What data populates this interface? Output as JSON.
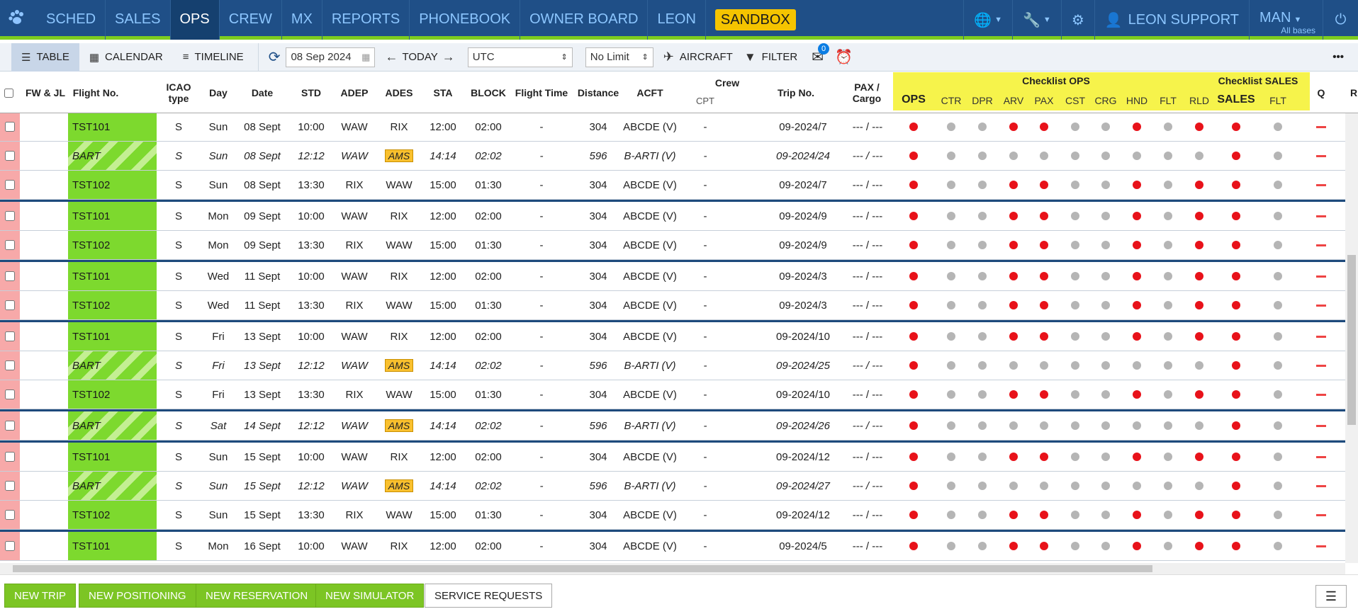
{
  "nav": {
    "items": [
      {
        "label": "SCHED"
      },
      {
        "label": "SALES"
      },
      {
        "label": "OPS"
      },
      {
        "label": "CREW"
      },
      {
        "label": "MX"
      },
      {
        "label": "REPORTS"
      },
      {
        "label": "PHONEBOOK"
      },
      {
        "label": "OWNER BOARD"
      },
      {
        "label": "LEON"
      }
    ],
    "active": "OPS",
    "sandbox": "SANDBOX",
    "user": "LEON SUPPORT",
    "base": "MAN",
    "base_sub": "All bases"
  },
  "toolbar": {
    "table": "TABLE",
    "calendar": "CALENDAR",
    "timeline": "TIMELINE",
    "date": "08 Sep 2024",
    "today": "TODAY",
    "timezone": "UTC",
    "limit": "No Limit",
    "aircraft": "AIRCRAFT",
    "filter": "FILTER",
    "messages_count": "0"
  },
  "columns": {
    "fw_jl": "FW & JL",
    "flight_no": "Flight No.",
    "icao_type": "ICAO type",
    "day": "Day",
    "date": "Date",
    "std": "STD",
    "adep": "ADEP",
    "ades": "ADES",
    "sta": "STA",
    "block": "BLOCK",
    "flight_time": "Flight Time",
    "distance": "Distance",
    "acft": "ACFT",
    "crew": "Crew",
    "cpt": "CPT",
    "trip_no": "Trip No.",
    "pax_cargo": "PAX / Cargo",
    "checklist_ops_title": "Checklist OPS",
    "checklist_sales_title": "Checklist SALES",
    "ops": "OPS",
    "ctr": "CTR",
    "dpr": "DPR",
    "arv": "ARV",
    "pax": "PAX",
    "cst": "CST",
    "crg": "CRG",
    "hnd": "HND",
    "flt": "FLT",
    "rld": "RLD",
    "sales": "SALES",
    "sales_flt": "FLT",
    "q": "Q",
    "r": "R"
  },
  "rows": [
    {
      "flight": "TST101",
      "type": "S",
      "day": "Sun",
      "date": "08 Sept",
      "std": "10:00",
      "adep": "WAW",
      "ades": "RIX",
      "sta": "12:00",
      "block": "02:00",
      "ft": "-",
      "dist": "304",
      "acft": "ABCDE (V)",
      "cpt": "-",
      "trip": "09-2024/7",
      "pax": "--- / ---",
      "bart": false,
      "sep": true,
      "checks": [
        "red",
        "gray",
        "gray",
        "red",
        "red",
        "gray",
        "gray",
        "red",
        "gray",
        "red",
        "red",
        "gray"
      ]
    },
    {
      "flight": "BART",
      "type": "S",
      "day": "Sun",
      "date": "08 Sept",
      "std": "12:12",
      "adep": "WAW",
      "ades": "AMS",
      "sta": "14:14",
      "block": "02:02",
      "ft": "-",
      "dist": "596",
      "acft": "B-ARTI (V)",
      "cpt": "-",
      "trip": "09-2024/24",
      "pax": "--- / ---",
      "bart": true,
      "sep": false,
      "checks": [
        "red",
        "gray",
        "gray",
        "gray",
        "gray",
        "gray",
        "gray",
        "gray",
        "gray",
        "gray",
        "red",
        "gray"
      ]
    },
    {
      "flight": "TST102",
      "type": "S",
      "day": "Sun",
      "date": "08 Sept",
      "std": "13:30",
      "adep": "RIX",
      "ades": "WAW",
      "sta": "15:00",
      "block": "01:30",
      "ft": "-",
      "dist": "304",
      "acft": "ABCDE (V)",
      "cpt": "-",
      "trip": "09-2024/7",
      "pax": "--- / ---",
      "bart": false,
      "sep": false,
      "checks": [
        "red",
        "gray",
        "gray",
        "red",
        "red",
        "gray",
        "gray",
        "red",
        "gray",
        "red",
        "red",
        "gray"
      ]
    },
    {
      "flight": "TST101",
      "type": "S",
      "day": "Mon",
      "date": "09 Sept",
      "std": "10:00",
      "adep": "WAW",
      "ades": "RIX",
      "sta": "12:00",
      "block": "02:00",
      "ft": "-",
      "dist": "304",
      "acft": "ABCDE (V)",
      "cpt": "-",
      "trip": "09-2024/9",
      "pax": "--- / ---",
      "bart": false,
      "sep": true,
      "checks": [
        "red",
        "gray",
        "gray",
        "red",
        "red",
        "gray",
        "gray",
        "red",
        "gray",
        "red",
        "red",
        "gray"
      ]
    },
    {
      "flight": "TST102",
      "type": "S",
      "day": "Mon",
      "date": "09 Sept",
      "std": "13:30",
      "adep": "RIX",
      "ades": "WAW",
      "sta": "15:00",
      "block": "01:30",
      "ft": "-",
      "dist": "304",
      "acft": "ABCDE (V)",
      "cpt": "-",
      "trip": "09-2024/9",
      "pax": "--- / ---",
      "bart": false,
      "sep": false,
      "checks": [
        "red",
        "gray",
        "gray",
        "red",
        "red",
        "gray",
        "gray",
        "red",
        "gray",
        "red",
        "red",
        "gray"
      ]
    },
    {
      "flight": "TST101",
      "type": "S",
      "day": "Wed",
      "date": "11 Sept",
      "std": "10:00",
      "adep": "WAW",
      "ades": "RIX",
      "sta": "12:00",
      "block": "02:00",
      "ft": "-",
      "dist": "304",
      "acft": "ABCDE (V)",
      "cpt": "-",
      "trip": "09-2024/3",
      "pax": "--- / ---",
      "bart": false,
      "sep": true,
      "checks": [
        "red",
        "gray",
        "gray",
        "red",
        "red",
        "gray",
        "gray",
        "red",
        "gray",
        "red",
        "red",
        "gray"
      ]
    },
    {
      "flight": "TST102",
      "type": "S",
      "day": "Wed",
      "date": "11 Sept",
      "std": "13:30",
      "adep": "RIX",
      "ades": "WAW",
      "sta": "15:00",
      "block": "01:30",
      "ft": "-",
      "dist": "304",
      "acft": "ABCDE (V)",
      "cpt": "-",
      "trip": "09-2024/3",
      "pax": "--- / ---",
      "bart": false,
      "sep": false,
      "checks": [
        "red",
        "gray",
        "gray",
        "red",
        "red",
        "gray",
        "gray",
        "red",
        "gray",
        "red",
        "red",
        "gray"
      ]
    },
    {
      "flight": "TST101",
      "type": "S",
      "day": "Fri",
      "date": "13 Sept",
      "std": "10:00",
      "adep": "WAW",
      "ades": "RIX",
      "sta": "12:00",
      "block": "02:00",
      "ft": "-",
      "dist": "304",
      "acft": "ABCDE (V)",
      "cpt": "-",
      "trip": "09-2024/10",
      "pax": "--- / ---",
      "bart": false,
      "sep": true,
      "checks": [
        "red",
        "gray",
        "gray",
        "red",
        "red",
        "gray",
        "gray",
        "red",
        "gray",
        "red",
        "red",
        "gray"
      ]
    },
    {
      "flight": "BART",
      "type": "S",
      "day": "Fri",
      "date": "13 Sept",
      "std": "12:12",
      "adep": "WAW",
      "ades": "AMS",
      "sta": "14:14",
      "block": "02:02",
      "ft": "-",
      "dist": "596",
      "acft": "B-ARTI (V)",
      "cpt": "-",
      "trip": "09-2024/25",
      "pax": "--- / ---",
      "bart": true,
      "sep": false,
      "checks": [
        "red",
        "gray",
        "gray",
        "gray",
        "gray",
        "gray",
        "gray",
        "gray",
        "gray",
        "gray",
        "red",
        "gray"
      ]
    },
    {
      "flight": "TST102",
      "type": "S",
      "day": "Fri",
      "date": "13 Sept",
      "std": "13:30",
      "adep": "RIX",
      "ades": "WAW",
      "sta": "15:00",
      "block": "01:30",
      "ft": "-",
      "dist": "304",
      "acft": "ABCDE (V)",
      "cpt": "-",
      "trip": "09-2024/10",
      "pax": "--- / ---",
      "bart": false,
      "sep": false,
      "checks": [
        "red",
        "gray",
        "gray",
        "red",
        "red",
        "gray",
        "gray",
        "red",
        "gray",
        "red",
        "red",
        "gray"
      ]
    },
    {
      "flight": "BART",
      "type": "S",
      "day": "Sat",
      "date": "14 Sept",
      "std": "12:12",
      "adep": "WAW",
      "ades": "AMS",
      "sta": "14:14",
      "block": "02:02",
      "ft": "-",
      "dist": "596",
      "acft": "B-ARTI (V)",
      "cpt": "-",
      "trip": "09-2024/26",
      "pax": "--- / ---",
      "bart": true,
      "sep": true,
      "checks": [
        "red",
        "gray",
        "gray",
        "gray",
        "gray",
        "gray",
        "gray",
        "gray",
        "gray",
        "gray",
        "red",
        "gray"
      ]
    },
    {
      "flight": "TST101",
      "type": "S",
      "day": "Sun",
      "date": "15 Sept",
      "std": "10:00",
      "adep": "WAW",
      "ades": "RIX",
      "sta": "12:00",
      "block": "02:00",
      "ft": "-",
      "dist": "304",
      "acft": "ABCDE (V)",
      "cpt": "-",
      "trip": "09-2024/12",
      "pax": "--- / ---",
      "bart": false,
      "sep": true,
      "checks": [
        "red",
        "gray",
        "gray",
        "red",
        "red",
        "gray",
        "gray",
        "red",
        "gray",
        "red",
        "red",
        "gray"
      ]
    },
    {
      "flight": "BART",
      "type": "S",
      "day": "Sun",
      "date": "15 Sept",
      "std": "12:12",
      "adep": "WAW",
      "ades": "AMS",
      "sta": "14:14",
      "block": "02:02",
      "ft": "-",
      "dist": "596",
      "acft": "B-ARTI (V)",
      "cpt": "-",
      "trip": "09-2024/27",
      "pax": "--- / ---",
      "bart": true,
      "sep": false,
      "checks": [
        "red",
        "gray",
        "gray",
        "gray",
        "gray",
        "gray",
        "gray",
        "gray",
        "gray",
        "gray",
        "red",
        "gray"
      ]
    },
    {
      "flight": "TST102",
      "type": "S",
      "day": "Sun",
      "date": "15 Sept",
      "std": "13:30",
      "adep": "RIX",
      "ades": "WAW",
      "sta": "15:00",
      "block": "01:30",
      "ft": "-",
      "dist": "304",
      "acft": "ABCDE (V)",
      "cpt": "-",
      "trip": "09-2024/12",
      "pax": "--- / ---",
      "bart": false,
      "sep": false,
      "checks": [
        "red",
        "gray",
        "gray",
        "red",
        "red",
        "gray",
        "gray",
        "red",
        "gray",
        "red",
        "red",
        "gray"
      ]
    },
    {
      "flight": "TST101",
      "type": "S",
      "day": "Mon",
      "date": "16 Sept",
      "std": "10:00",
      "adep": "WAW",
      "ades": "RIX",
      "sta": "12:00",
      "block": "02:00",
      "ft": "-",
      "dist": "304",
      "acft": "ABCDE (V)",
      "cpt": "-",
      "trip": "09-2024/5",
      "pax": "--- / ---",
      "bart": false,
      "sep": true,
      "checks": [
        "red",
        "gray",
        "gray",
        "red",
        "red",
        "gray",
        "gray",
        "red",
        "gray",
        "red",
        "red",
        "gray"
      ]
    }
  ],
  "footer": {
    "new_trip": "NEW TRIP",
    "new_positioning": "NEW POSITIONING",
    "new_reservation": "NEW RESERVATION",
    "new_simulator": "NEW SIMULATOR",
    "service_requests": "SERVICE REQUESTS"
  },
  "colors": {
    "nav_bg": "#1f4f87",
    "accent_green": "#7dcc1f",
    "flight_green": "#7dd92e",
    "checklist_yellow": "#f6f34b",
    "status_red": "#e8121a",
    "status_gray": "#b5b5b5",
    "ams_badge": "#f9c02e"
  },
  "icons": [
    "paw-logo-icon",
    "globe-icon",
    "wrench-icon",
    "gear-icon",
    "user-icon",
    "power-icon",
    "table-icon",
    "calendar-icon",
    "timeline-icon",
    "refresh-icon",
    "calendar-picker-icon",
    "arrow-left-icon",
    "arrow-right-icon",
    "airplane-icon",
    "filter-icon",
    "envelope-icon",
    "alarm-icon",
    "more-icon",
    "hamburger-icon"
  ]
}
